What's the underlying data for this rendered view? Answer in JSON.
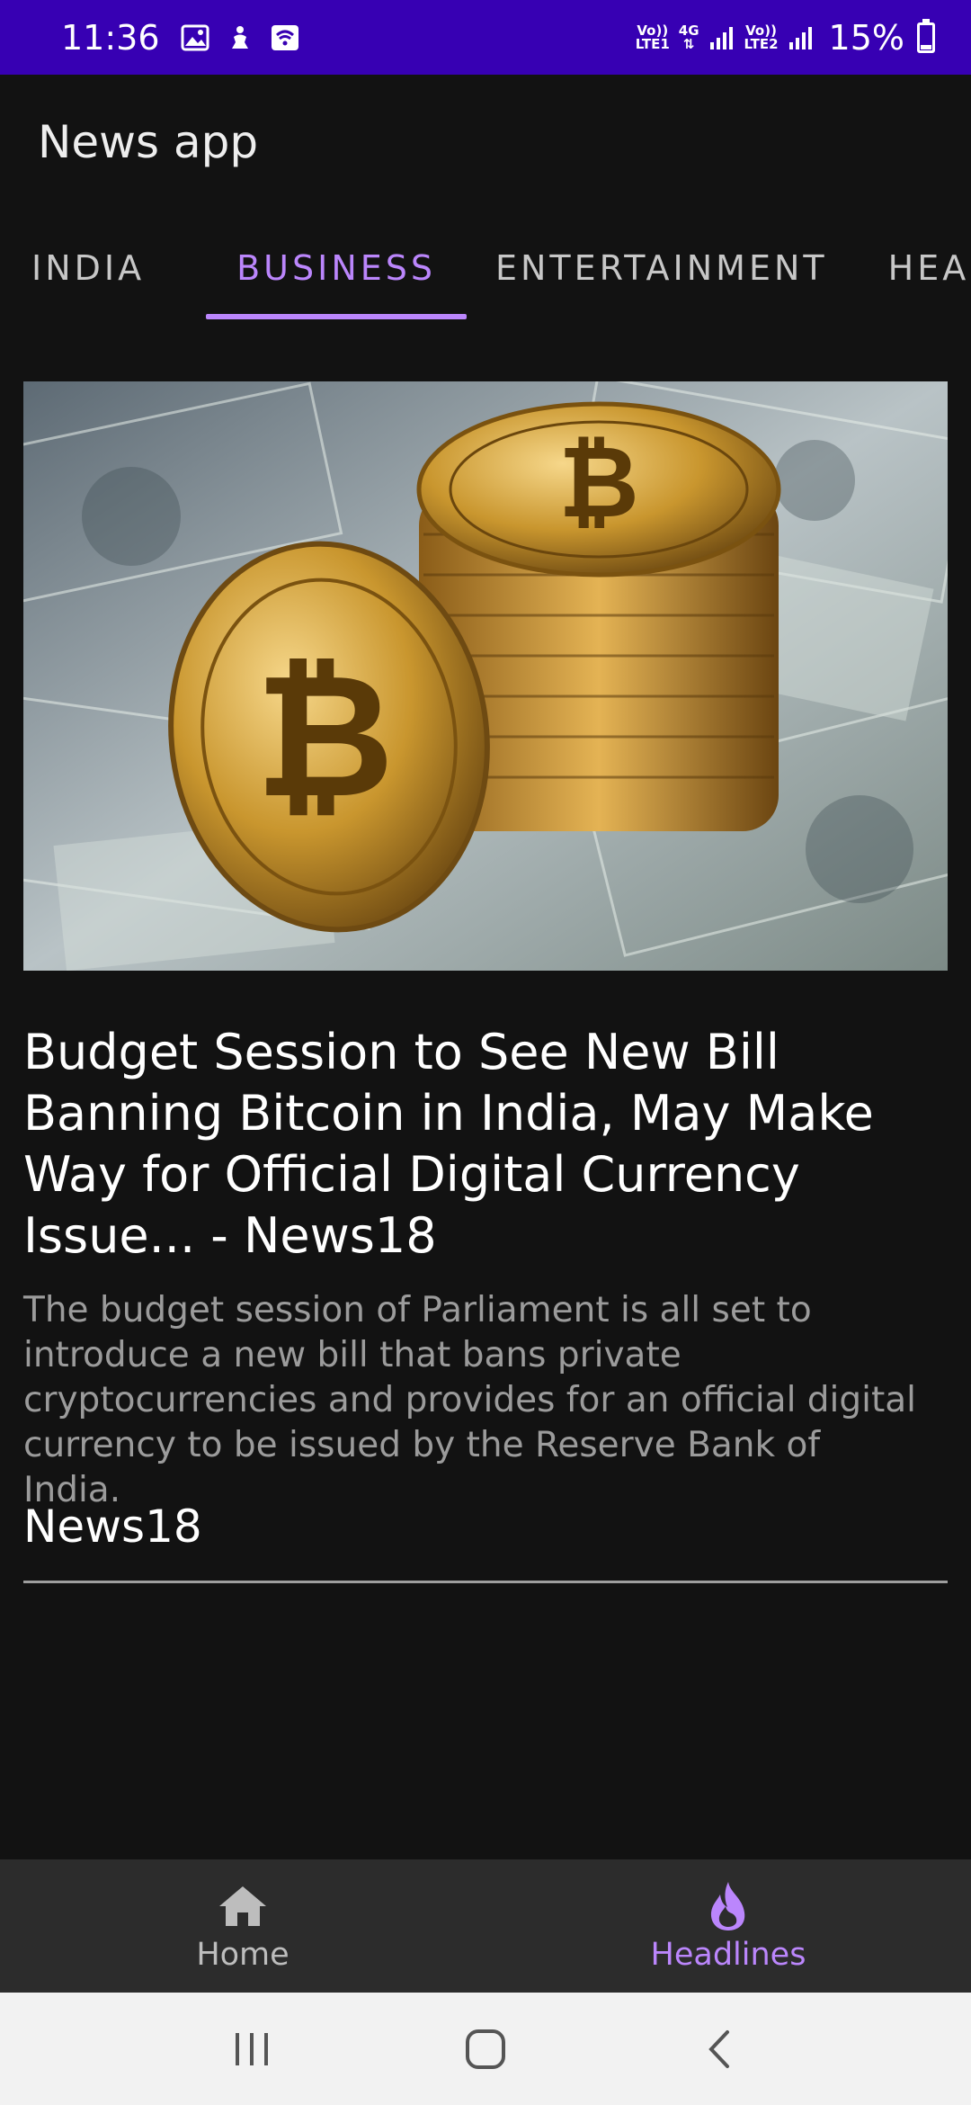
{
  "status_bar": {
    "time": "11:36",
    "net1_top": "Vo))",
    "net1_bottom": "LTE1",
    "net_type": "4G",
    "net2_top": "Vo))",
    "net2_bottom": "LTE2",
    "battery": "15%",
    "battery_level": 0.15
  },
  "toolbar": {
    "title": "News app"
  },
  "tabs": [
    {
      "label": "INDIA"
    },
    {
      "label": "BUSINESS",
      "selected": true
    },
    {
      "label": "ENTERTAINMENT"
    },
    {
      "label": "HEALTH"
    }
  ],
  "article": {
    "image_icon": "bitcoin-photo",
    "title": "Budget Session to See New Bill Banning Bitcoin in India, May Make Way for Official Digital Currency Issue... - News18",
    "description": "The budget session of Parliament is all set to introduce a new bill that bans private cryptocurrencies and provides for an official digital currency to be issued by the Reserve Bank of India.",
    "source": "News18"
  },
  "bottom_nav": {
    "items": [
      {
        "label": "Home",
        "icon": "home-icon"
      },
      {
        "label": "Headlines",
        "icon": "flame-icon",
        "selected": true
      }
    ]
  },
  "colors": {
    "status_bar": "#3700b3",
    "accent": "#bb86fc",
    "background": "#121212",
    "nav_background": "#2c2c2c"
  }
}
